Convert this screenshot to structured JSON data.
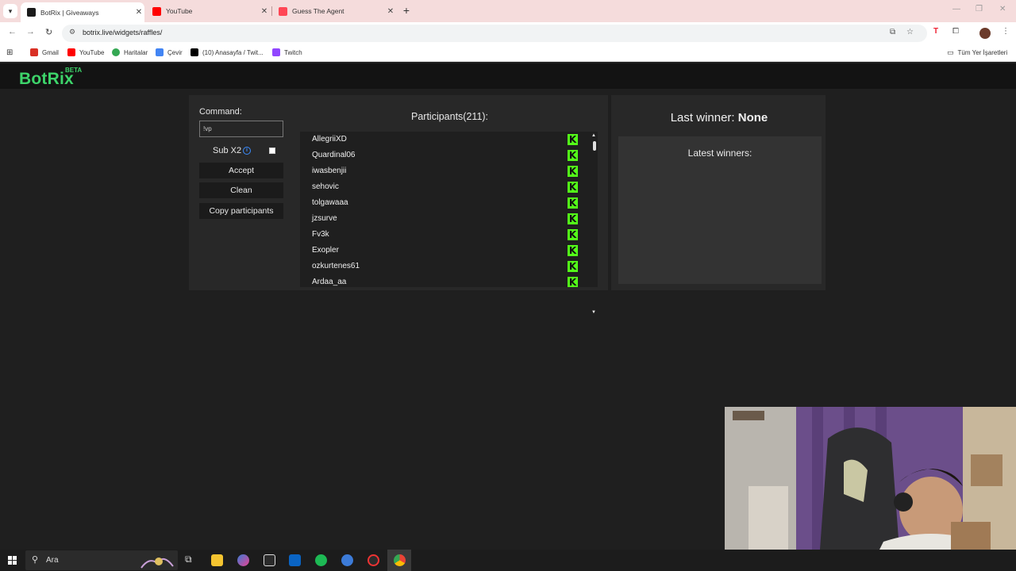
{
  "browser": {
    "tabs": [
      {
        "title": "BotRix | Giveaways",
        "active": true,
        "color": "#1a1a1a"
      },
      {
        "title": "YouTube",
        "active": false,
        "color": "#ff0000"
      },
      {
        "title": "Guess The Agent",
        "active": false,
        "color": "#ff4655"
      }
    ],
    "url": "botrix.live/widgets/raffles/",
    "bookmarks": [
      {
        "label": "Gmail",
        "color": "#d93025"
      },
      {
        "label": "YouTube",
        "color": "#ff0000"
      },
      {
        "label": "Haritalar",
        "color": "#34a853"
      },
      {
        "label": "Çevir",
        "color": "#4285f4"
      },
      {
        "label": "(10) Anasayfa / Twit...",
        "color": "#000000"
      },
      {
        "label": "Twitch",
        "color": "#9146ff"
      }
    ],
    "all_bookmarks": "Tüm Yer İşaretleri"
  },
  "site": {
    "logo": "BotRix",
    "beta": "BETA",
    "accent": "#3dd46a"
  },
  "raffle": {
    "command_label": "Command:",
    "command_value": "!vp",
    "sub_x2_label": "Sub X2",
    "sub_x2_checked": false,
    "accept_label": "Accept",
    "clean_label": "Clean",
    "copy_label": "Copy participants",
    "participants_title": "Participants(211):",
    "participants": [
      "AllegriiXD",
      "Quardinal06",
      "iwasbenjii",
      "sehovic",
      "tolgawaaa",
      "jzsurve",
      "Fv3k",
      "Exopler",
      "ozkurtenes61",
      "Ardaa_aa"
    ],
    "platform_icon": "kick-icon",
    "platform_glyph": "K",
    "platform_color": "#53fc18"
  },
  "winners": {
    "last_winner_label": "Last winner:",
    "last_winner_value": "None",
    "latest_title": "Latest winners:"
  },
  "taskbar": {
    "search_text": "Ara"
  }
}
